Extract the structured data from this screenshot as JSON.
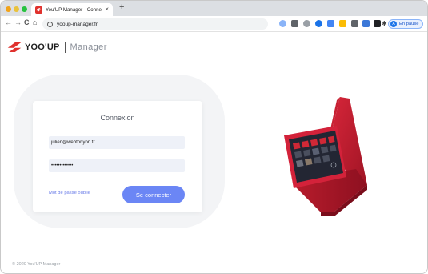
{
  "browser": {
    "tab": {
      "title": "You'UP Manager - Connexion",
      "close": "×"
    },
    "new_tab": "+",
    "nav": {
      "back": "←",
      "forward": "→",
      "reload": "C",
      "home": "⌂"
    },
    "address": "yooup-manager.fr",
    "profile": {
      "initial": "A",
      "status": "En pause"
    },
    "menu": "⋮",
    "extension_icons": [
      "sync-icon",
      "tile-icon",
      "puzzle-icon",
      "g-icon",
      "square-icon",
      "a-icon",
      "grid-icon",
      "cast-icon",
      "dark-icon",
      "star-icon"
    ]
  },
  "brand": {
    "name": "YOO'UP",
    "product": "Manager",
    "color": "#e0312d"
  },
  "login": {
    "title": "Connexion",
    "email": "julien@webforlyon.fr",
    "password_mask": "•••••••••••••",
    "forgot_label": "Mot de passe oublié",
    "submit_label": "Se connecter"
  },
  "footer": "© 2020 You'UP Manager",
  "colors": {
    "accent": "#6b86f5",
    "brand_red": "#c8202f"
  }
}
